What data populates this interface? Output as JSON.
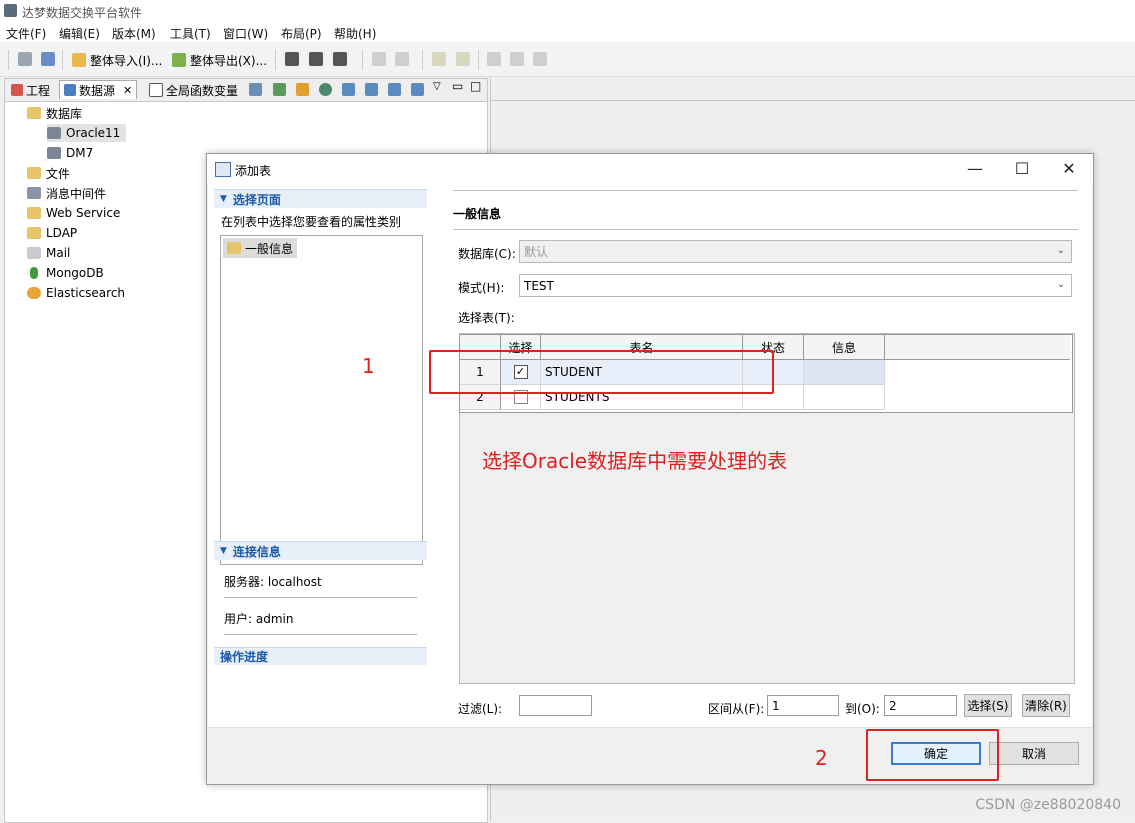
{
  "app": {
    "title": "达梦数据交换平台软件",
    "menu": [
      "文件(F)",
      "编辑(E)",
      "版本(M)",
      "工具(T)",
      "窗口(W)",
      "布局(P)",
      "帮助(H)"
    ],
    "toolbar": {
      "import_label": "整体导入(I)...",
      "export_label": "整体导出(X)..."
    }
  },
  "left_panel": {
    "tabs": [
      "工程",
      "数据源",
      "全局函数变量"
    ],
    "tree": [
      {
        "label": "数据库",
        "icon": "database-folder-icon"
      },
      {
        "label": "Oracle11",
        "icon": "db-connection-icon"
      },
      {
        "label": "DM7",
        "icon": "db-connection-icon"
      },
      {
        "label": "文件",
        "icon": "folder-icon"
      },
      {
        "label": "消息中间件",
        "icon": "mq-icon"
      },
      {
        "label": "Web Service",
        "icon": "folder-icon"
      },
      {
        "label": "LDAP",
        "icon": "folder-icon"
      },
      {
        "label": "Mail",
        "icon": "mail-icon"
      },
      {
        "label": "MongoDB",
        "icon": "mongodb-icon"
      },
      {
        "label": "Elasticsearch",
        "icon": "elasticsearch-icon"
      }
    ]
  },
  "dialog": {
    "title": "添加表",
    "sidebar": {
      "select_page_header": "选择页面",
      "select_page_hint": "在列表中选择您要查看的属性类别",
      "pages": [
        "一般信息"
      ],
      "connection_header": "连接信息",
      "server": "服务器: localhost",
      "user": "用户: admin",
      "progress_header": "操作进度"
    },
    "main": {
      "section_title": "一般信息",
      "database_label": "数据库(C):",
      "database_value": "默认",
      "schema_label": "模式(H):",
      "schema_value": "TEST",
      "tables_label": "选择表(T):",
      "columns": [
        "选择",
        "表名",
        "状态",
        "信息"
      ],
      "rows": [
        {
          "num": "1",
          "checked": true,
          "name": "STUDENT",
          "status": "",
          "info": ""
        },
        {
          "num": "2",
          "checked": false,
          "name": "STUDENTS",
          "status": "",
          "info": ""
        }
      ],
      "filter_label": "过滤(L):",
      "filter_value": "",
      "range_from_label": "区间从(F):",
      "range_from_value": "1",
      "range_to_label": "到(O):",
      "range_to_value": "2",
      "select_button": "选择(S)",
      "clear_button": "清除(R)"
    },
    "footer": {
      "ok_button": "确定",
      "cancel_button": "取消"
    }
  },
  "annotations": {
    "step1": "1",
    "step2": "2",
    "note": "选择Oracle数据库中需要处理的表",
    "color": "#e02020"
  },
  "watermark": "CSDN @ze88020840"
}
